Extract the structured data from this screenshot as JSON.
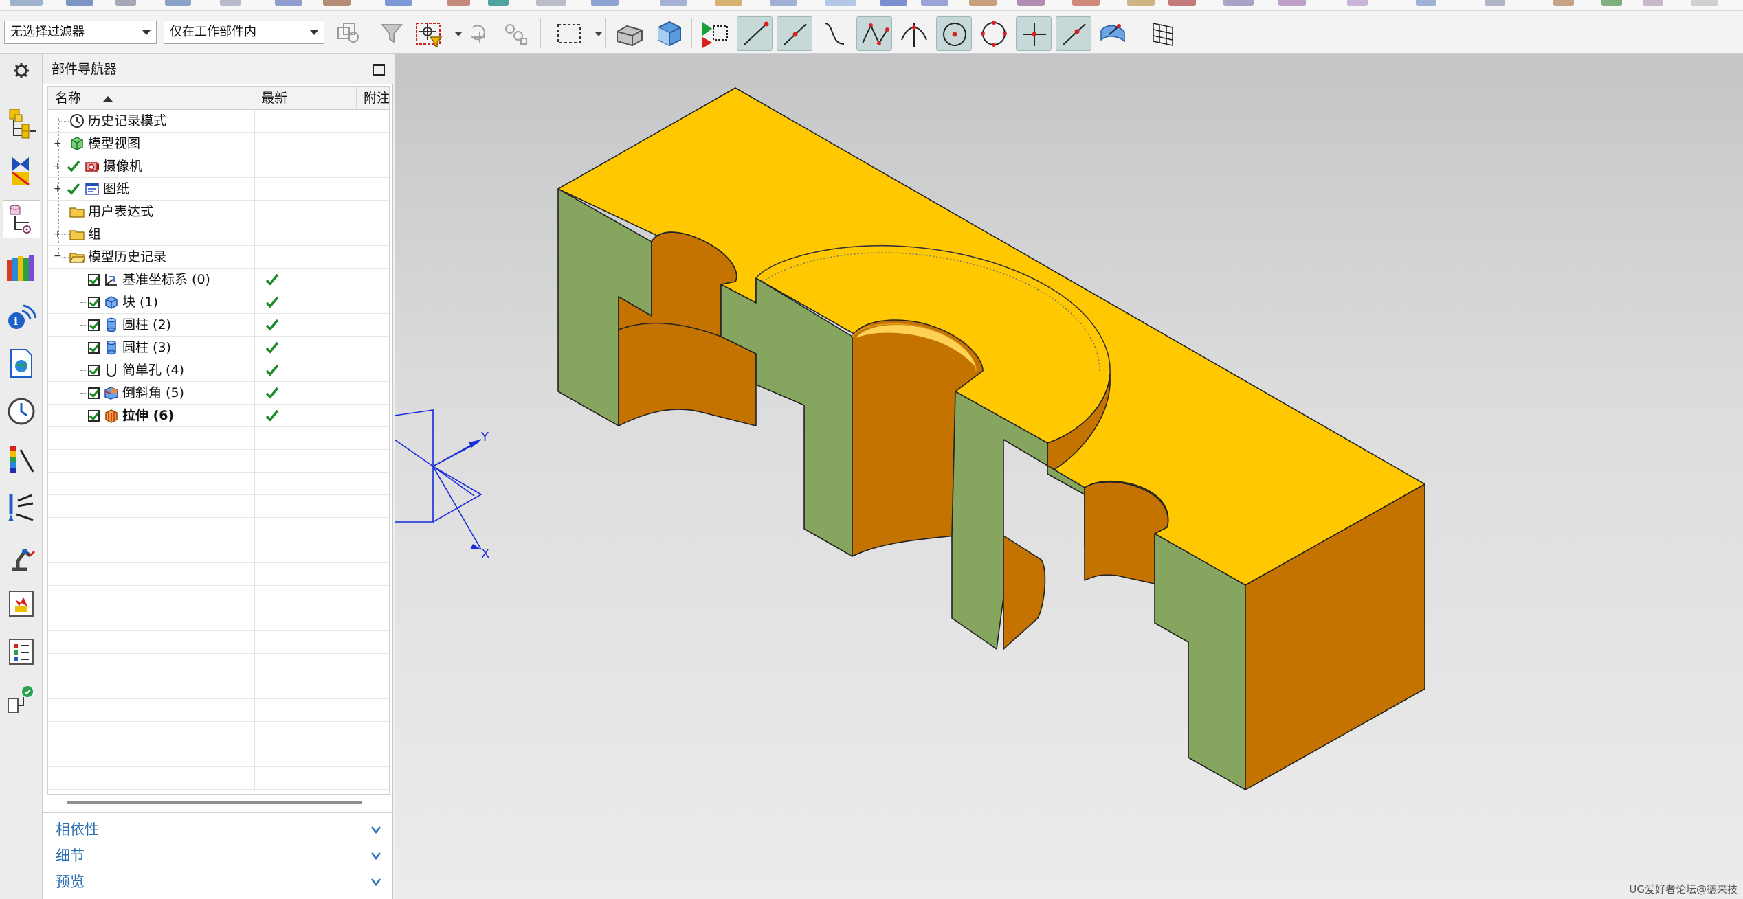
{
  "toolbar": {
    "filter_value": "无选择过滤器",
    "scope_value": "仅在工作部件内",
    "tools": [
      "cube-snap",
      "selection-filter",
      "point-constructor",
      "box-select",
      "view-orient",
      "view-render",
      "snap-all",
      "snap-end",
      "snap-mid",
      "snap-curve",
      "snap-control",
      "snap-intersection",
      "snap-center",
      "snap-quadrant",
      "snap-exist",
      "snap-on-curve",
      "snap-surface",
      "snap-grid"
    ]
  },
  "rail": {
    "items": [
      "settings-icon",
      "assembly-navigator-icon",
      "constraint-navigator-icon",
      "part-navigator-icon",
      "reuse-library-icon",
      "hd3d-tools-icon",
      "web-browser-icon",
      "history-icon",
      "visualization-icon",
      "machining-icon",
      "manufacturing-icon",
      "process-studio-icon",
      "roles-icon",
      "system-icon"
    ]
  },
  "navigator": {
    "title": "部件导航器",
    "columns": {
      "name": "名称",
      "latest": "最新",
      "comment": "附注"
    },
    "rows": [
      {
        "label": "历史记录模式",
        "icon": "clock-icon",
        "latest": ""
      },
      {
        "label": "模型视图",
        "icon": "model-view-icon",
        "latest": ""
      },
      {
        "label": "摄像机",
        "icon": "camera-icon",
        "latest": ""
      },
      {
        "label": "图纸",
        "icon": "drawing-icon",
        "latest": ""
      },
      {
        "label": "用户表达式",
        "icon": "folder-icon",
        "latest": ""
      },
      {
        "label": "组",
        "icon": "folder-icon",
        "latest": ""
      },
      {
        "label": "模型历史记录",
        "icon": "folder-open-icon",
        "latest": ""
      },
      {
        "label": "基准坐标系 (0)",
        "icon": "datum-csys-icon",
        "latest": "✔"
      },
      {
        "label": "块 (1)",
        "icon": "block-icon",
        "latest": "✔"
      },
      {
        "label": "圆柱 (2)",
        "icon": "cylinder-icon",
        "latest": "✔"
      },
      {
        "label": "圆柱 (3)",
        "icon": "cylinder-icon",
        "latest": "✔"
      },
      {
        "label": "简单孔 (4)",
        "icon": "hole-icon",
        "latest": "✔"
      },
      {
        "label": "倒斜角 (5)",
        "icon": "chamfer-icon",
        "latest": "✔"
      },
      {
        "label": "拉伸 (6)",
        "icon": "extrude-icon",
        "latest": "✔"
      }
    ],
    "panels": [
      "相依性",
      "细节",
      "预览"
    ]
  },
  "viewport": {
    "axis_labels": {
      "x": "X",
      "y": "Y"
    },
    "watermark": "UG爱好者论坛@德来技"
  },
  "colors": {
    "top_face": "#ffc800",
    "side_face": "#86a660",
    "front_face": "#c47300",
    "bore_dark": "#8a4a00",
    "axis_blue": "#1a2bd9",
    "link_blue": "#2a6fb3"
  }
}
